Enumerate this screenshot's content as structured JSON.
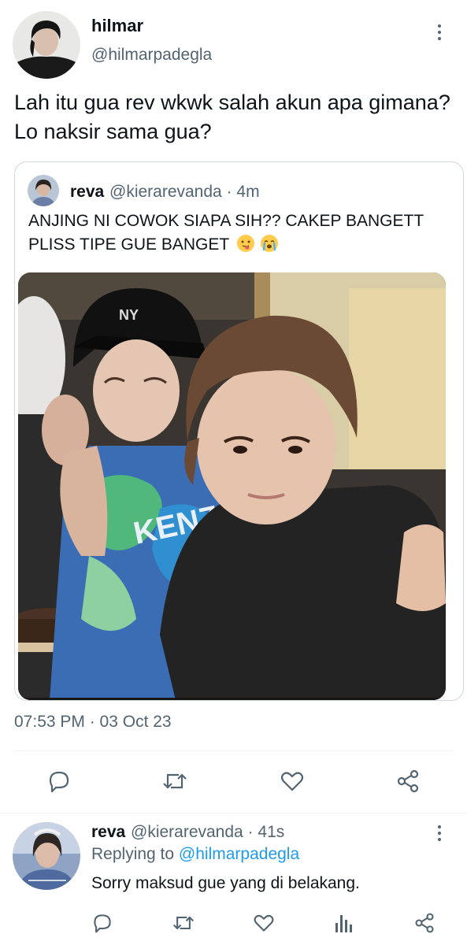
{
  "main_tweet": {
    "author_name": "hilmar",
    "author_handle": "@hilmarpadegla",
    "text": "Lah itu gua rev wkwk salah akun apa gimana? Lo naksir sama gua?",
    "timestamp": "07:53 PM · 03 Oct 23"
  },
  "quoted_tweet": {
    "author_name": "reva",
    "author_handle": "@kierarevanda",
    "time": "4m",
    "text": "ANJING NI COWOK SIAPA SIH?? CAKEP BANGETT PLISS TIPE GUE BANGET",
    "emojis": [
      "face-with-tongue",
      "loudly-crying-face"
    ],
    "photo_content": "KENZO"
  },
  "main_actions": [
    "reply-icon",
    "retweet-icon",
    "like-icon",
    "share-icon"
  ],
  "reply": {
    "author_name": "reva",
    "author_handle": "@kierarevanda",
    "time": "41s",
    "replying_prefix": "Replying to",
    "replying_handle": "@hilmarpadegla",
    "text": "Sorry maksud gue yang di belakang."
  },
  "reply_actions": [
    "reply-icon",
    "retweet-icon",
    "like-icon",
    "views-icon",
    "share-icon"
  ],
  "colors": {
    "text_primary": "#0f1419",
    "text_secondary": "#536471",
    "link": "#1d9bf0",
    "border": "#cfd9de"
  }
}
